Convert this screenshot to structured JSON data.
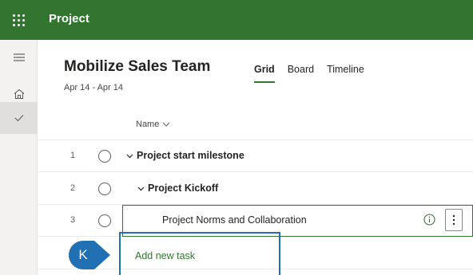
{
  "app": {
    "title": "Project"
  },
  "plan": {
    "name": "Mobilize Sales Team",
    "dates": "Apr 14 - Apr 14"
  },
  "tabs": [
    {
      "label": "Grid",
      "active": true
    },
    {
      "label": "Board",
      "active": false
    },
    {
      "label": "Timeline",
      "active": false
    }
  ],
  "grid": {
    "column_name": "Name",
    "rows": [
      {
        "number": "1",
        "name": "Project start milestone",
        "bold": true,
        "chevron": true
      },
      {
        "number": "2",
        "name": "Project Kickoff",
        "bold": true,
        "chevron": true
      },
      {
        "number": "3",
        "name": "Project Norms and Collaboration",
        "bold": false,
        "chevron": false
      }
    ],
    "add_task_label": "Add new task"
  },
  "keytip": {
    "letter": "K"
  },
  "colors": {
    "accent": "#31752f",
    "keytip": "#1f6fb2"
  },
  "icons": [
    "waffle-icon",
    "hamburger-icon",
    "home-icon",
    "checkmark-icon",
    "chevron-down-icon",
    "info-icon",
    "more-vertical-icon"
  ]
}
